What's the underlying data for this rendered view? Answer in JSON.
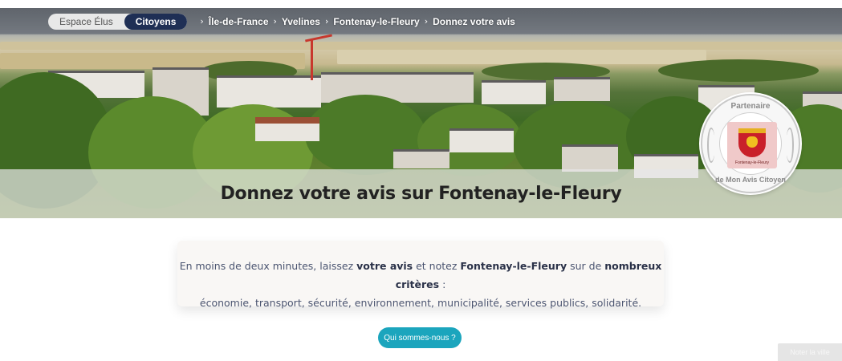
{
  "breadcrumb": {
    "toggle": {
      "option_1": "Espace Élus",
      "option_2": "Citoyens"
    },
    "items": [
      "Île-de-France",
      "Yvelines",
      "Fontenay-le-Fleury",
      "Donnez votre avis"
    ]
  },
  "hero": {
    "title": "Donnez votre avis sur Fontenay-le-Fleury"
  },
  "badge": {
    "top": "Partenaire",
    "bottom": "de Mon Avis Citoyen",
    "crest_caption": "Fontenay-le-Fleury"
  },
  "info": {
    "line1": {
      "a": "En moins de deux minutes, laissez ",
      "b": "votre avis",
      "c": " et notez ",
      "d": "Fontenay-le-Fleury",
      "e": " sur de ",
      "f": "nombreux critères",
      "g": " :"
    },
    "line2": "économie, transport, sécurité, environnement, municipalité, services publics, solidarité."
  },
  "cta_label": "Qui sommes-nous ?",
  "corner_button": "Noter la ville",
  "colors": {
    "accent": "#1ba5bd",
    "toggle_active": "#1f2f55"
  }
}
